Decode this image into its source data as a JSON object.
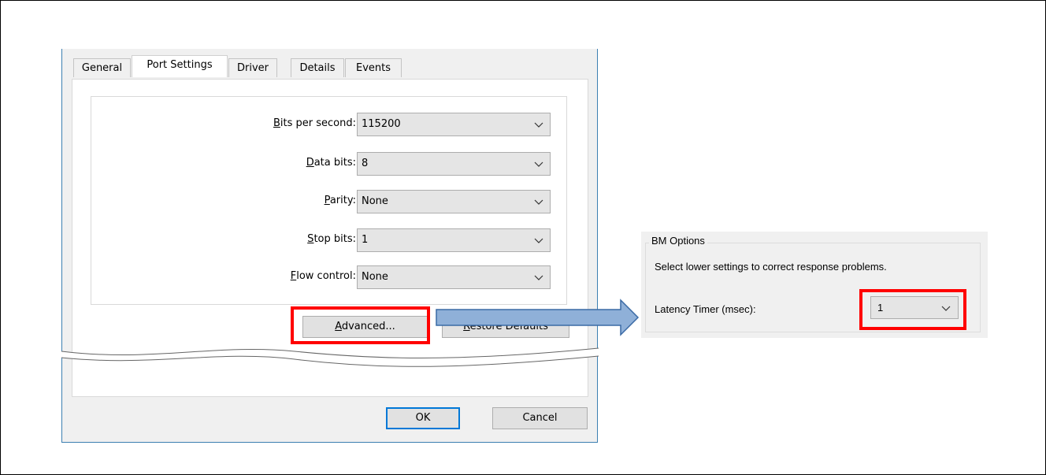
{
  "dialog": {
    "tabs": [
      {
        "label": "General",
        "active": false
      },
      {
        "label": "Port Settings",
        "active": true
      },
      {
        "label": "Driver",
        "active": false
      },
      {
        "label": "Details",
        "active": false
      },
      {
        "label": "Events",
        "active": false
      }
    ],
    "fields": [
      {
        "label_access": "B",
        "label_rest": "its per second:",
        "value": "115200"
      },
      {
        "label_access": "D",
        "label_rest": "ata bits:",
        "value": "8"
      },
      {
        "label_access": "P",
        "label_rest": "arity:",
        "value": "None"
      },
      {
        "label_access": "S",
        "label_rest": "top bits:",
        "value": "1"
      },
      {
        "label_access": "F",
        "label_rest": "low control:",
        "value": "None"
      }
    ],
    "advanced_button": {
      "access": "A",
      "rest": "dvanced..."
    },
    "restore_button": {
      "access": "R",
      "rest": "estore Defaults"
    },
    "ok_label": "OK",
    "cancel_label": "Cancel"
  },
  "bm_options": {
    "legend": "BM Options",
    "hint": "Select lower settings to correct response problems.",
    "latency_label": "Latency Timer (msec):",
    "latency_value": "1"
  },
  "colors": {
    "highlight": "#ff0000",
    "arrow_fill": "#8fb0d8",
    "arrow_stroke": "#3a6aa5",
    "dialog_border": "#3c7fb1",
    "focus_blue": "#0078d7"
  },
  "icons": {
    "dropdown": "chevron-down-icon",
    "pointer": "arrow-right-icon",
    "break": "wavy-break-lines"
  }
}
